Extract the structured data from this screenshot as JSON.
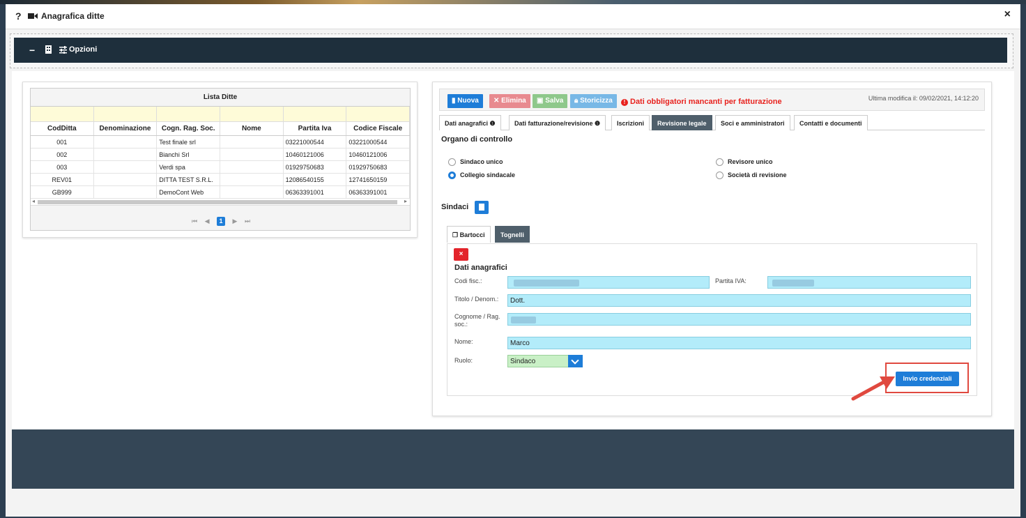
{
  "modal": {
    "help": "?",
    "title": "Anagrafica ditte",
    "close": "×"
  },
  "options_bar": {
    "collapse": "−",
    "label": "Opzioni"
  },
  "grid": {
    "title": "Lista Ditte",
    "columns": [
      "CodDitta",
      "Denominazione",
      "Cogn. Rag. Soc.",
      "Nome",
      "Partita Iva",
      "Codice Fiscale"
    ],
    "rows": [
      [
        "001",
        "",
        "Test finale srl",
        "",
        "03221000544",
        "03221000544"
      ],
      [
        "002",
        "",
        "Bianchi Srl",
        "",
        "10460121006",
        "10460121006"
      ],
      [
        "003",
        "",
        "Verdi spa",
        "",
        "01929750683",
        "01929750683"
      ],
      [
        "REV01",
        "",
        "DITTA TEST S.R.L.",
        "",
        "12086540155",
        "12741650159"
      ],
      [
        "GB999",
        "",
        "DemoCont Web",
        "",
        "06363391001",
        "06363391001"
      ]
    ],
    "pager": {
      "first": "⏮",
      "prev": "◀",
      "page": "1",
      "next": "▶",
      "last": "⏭"
    }
  },
  "toolbar": {
    "nuova": "Nuova",
    "elimina": "Elimina",
    "salva": "Salva",
    "storicizza": "Storicizza",
    "warning": "Dati obbligatori mancanti per fatturazione",
    "last_modified": "Ultima modifica il: 09/02/2021, 14:12:20"
  },
  "tabs": [
    "Dati anagrafici",
    "Dati fatturazione/revisione",
    "Iscrizioni",
    "Revisione legale",
    "Soci e amministratori",
    "Contatti e documenti"
  ],
  "organo": {
    "title": "Organo di controllo",
    "options": [
      "Sindaco unico",
      "Collegio sindacale",
      "Revisore unico",
      "Società di revisione"
    ]
  },
  "sindaci": {
    "label": "Sindaci",
    "subtabs": [
      "Bartocci",
      "Tognelli"
    ]
  },
  "form": {
    "section_title": "Dati anagrafici",
    "delete": "×",
    "codfisc_label": "Codi fisc.:",
    "piva_label": "Partita IVA:",
    "titolo_label": "Titolo / Denom.:",
    "titolo_value": "Dott.",
    "cognome_label": "Cognome / Rag. soc.:",
    "nome_label": "Nome:",
    "nome_value": "Marco",
    "ruolo_label": "Ruolo:",
    "ruolo_value": "Sindaco",
    "invio": "Invio credenziali"
  },
  "colors": {
    "primary": "#1e7dd8",
    "danger": "#e3242b",
    "header_dark": "#1e2f3c",
    "input_bg": "#b3ecfa",
    "highlight": "#e0493f"
  }
}
